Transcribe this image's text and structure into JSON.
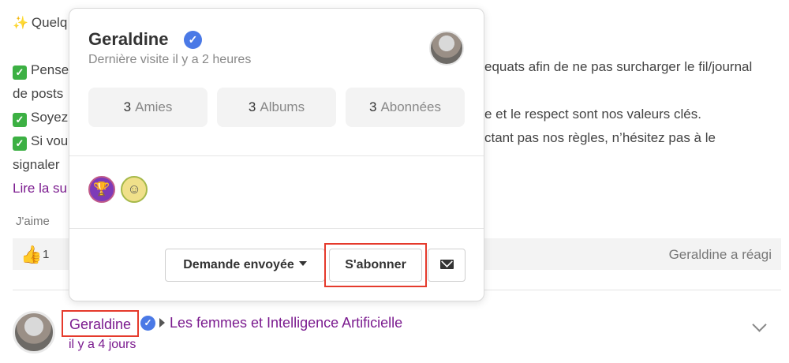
{
  "post": {
    "lines": [
      {
        "icon": "sparkles",
        "text": "Quelq"
      },
      {
        "icon": "",
        "text": ""
      },
      {
        "icon": "check",
        "text": "Pense"
      },
      {
        "icon": "",
        "text": "de posts"
      },
      {
        "icon": "check",
        "text": "Soyez"
      },
      {
        "icon": "check",
        "text": "Si vou"
      },
      {
        "icon": "",
        "text": "signaler"
      }
    ],
    "right_fragments": [
      "equats afin de ne pas surcharger le fil/journal",
      "e et le respect sont nos valeurs clés.",
      "ctant pas nos règles, n’hésitez pas à le"
    ],
    "read_more": "Lire la su",
    "like_label": "J'aime",
    "reaction_count": "1",
    "reacted_text": "Geraldine a réagi"
  },
  "author": {
    "name": "Geraldine",
    "group": "Les femmes et Intelligence Artificielle",
    "time_ago": "il y a 4 jours"
  },
  "profile_card": {
    "name": "Geraldine",
    "last_visit": "Dernière visite il y a 2 heures",
    "stats": [
      {
        "count": "3",
        "label": "Amies"
      },
      {
        "count": "3",
        "label": "Albums"
      },
      {
        "count": "3",
        "label": "Abonnées"
      }
    ],
    "badges": [
      "trophy-badge",
      "smiley-badge"
    ],
    "buttons": {
      "request": "Demande envoyée",
      "subscribe": "S'abonner",
      "message_icon": "envelope-icon"
    }
  },
  "colors": {
    "link": "#7b1b8f",
    "verified": "#4a79e6",
    "highlight": "#e53a2c"
  }
}
